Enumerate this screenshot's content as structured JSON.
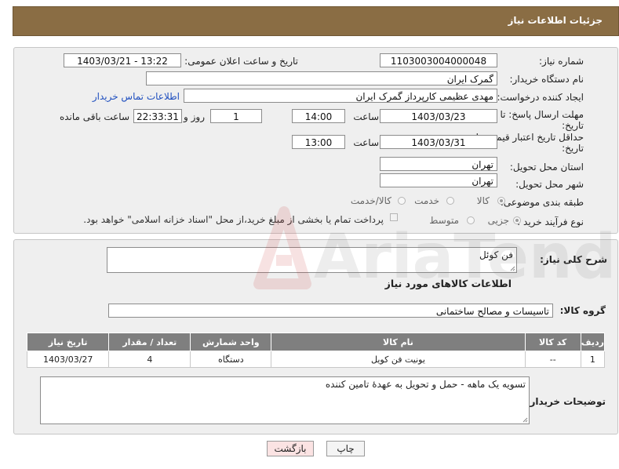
{
  "header": {
    "title": "جزئیات اطلاعات نیاز"
  },
  "form": {
    "need_number_label": "شماره نیاز:",
    "need_number": "1103003004000048",
    "announce_label": "تاریخ و ساعت اعلان عمومی:",
    "announce_value": "1403/03/21 - 13:22",
    "buyer_org_label": "نام دستگاه خریدار:",
    "buyer_org": "گمرک ایران",
    "creator_label": "ایجاد کننده درخواست:",
    "creator": "مهدی عظیمی کارپرداز گمرک ایران",
    "contact_link": "اطلاعات تماس خریدار",
    "deadline_label_1": "مهلت ارسال پاسخ: تا",
    "deadline_label_2": "تاریخ:",
    "deadline_date": "1403/03/23",
    "time_label": "ساعت",
    "deadline_time": "14:00",
    "days_value": "1",
    "days_label": "روز و",
    "remaining_time": "22:33:31",
    "remaining_label": "ساعت باقی مانده",
    "validity_label_1": "حداقل تاریخ اعتبار قیمت: تا",
    "validity_label_2": "تاریخ:",
    "validity_date": "1403/03/31",
    "validity_time": "13:00",
    "province_label": "استان محل تحویل:",
    "province": "تهران",
    "city_label": "شهر محل تحویل:",
    "city": "تهران",
    "category_label": "طبقه بندی موضوعی:",
    "category_options": [
      "کالا",
      "خدمت",
      "کالا/خدمت"
    ],
    "process_label": "نوع فرآیند خرید :",
    "process_options": [
      "جزیی",
      "متوسط"
    ],
    "payment_note": "پرداخت تمام یا بخشی از مبلغ خرید،از محل \"اسناد خزانه اسلامی\" خواهد بود."
  },
  "description": {
    "label": "شرح کلی نیاز:",
    "value": "فن کوئل"
  },
  "goods": {
    "section_title": "اطلاعات کالاهای مورد نیاز",
    "group_label": "گروه کالا:",
    "group_value": "تاسیسات و مصالح ساختمانی",
    "table": {
      "headers": [
        "ردیف",
        "کد کالا",
        "نام کالا",
        "واحد شمارش",
        "تعداد / مقدار",
        "تاریخ نیاز"
      ],
      "rows": [
        [
          "1",
          "--",
          "یونیت فن کویل",
          "دستگاه",
          "4",
          "1403/03/27"
        ]
      ]
    },
    "buyer_notes_label": "توضیحات خریدار:",
    "buyer_notes": "تسویه یک ماهه - حمل و تحویل به عهدهٔ تامین کننده"
  },
  "buttons": {
    "print": "چاپ",
    "back": "بازگشت"
  },
  "watermark": {
    "text": "AriaTender.net"
  },
  "colors": {
    "header": "#8a6d44",
    "panel": "#efefef",
    "table_header": "#7f7f7f",
    "link": "#1f4fbf",
    "back_button": "#fbe3e3"
  }
}
